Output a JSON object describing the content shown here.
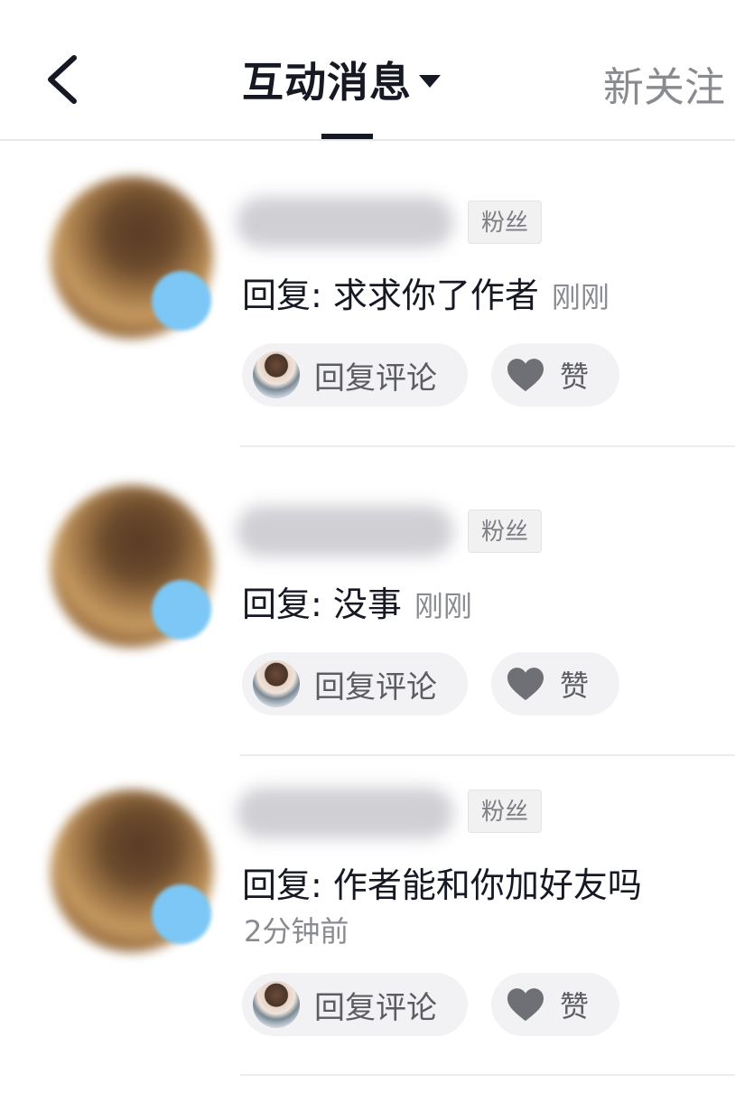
{
  "header": {
    "active_tab": "互动消息",
    "other_tab": "新关注"
  },
  "items": [
    {
      "badge": "粉丝",
      "reply": "回复: 求求你了作者",
      "time": "刚刚",
      "reply_btn": "回复评论",
      "like_btn": "赞"
    },
    {
      "badge": "粉丝",
      "reply": "回复: 没事",
      "time": "刚刚",
      "reply_btn": "回复评论",
      "like_btn": "赞"
    },
    {
      "badge": "粉丝",
      "reply": "回复: 作者能和你加好友吗",
      "time": "2分钟前",
      "reply_btn": "回复评论",
      "like_btn": "赞"
    }
  ],
  "colors": {
    "text_primary": "#161823",
    "text_secondary": "#8a8b91",
    "chip_bg": "#f2f2f4",
    "badge_blue": "#7cc7f5"
  }
}
